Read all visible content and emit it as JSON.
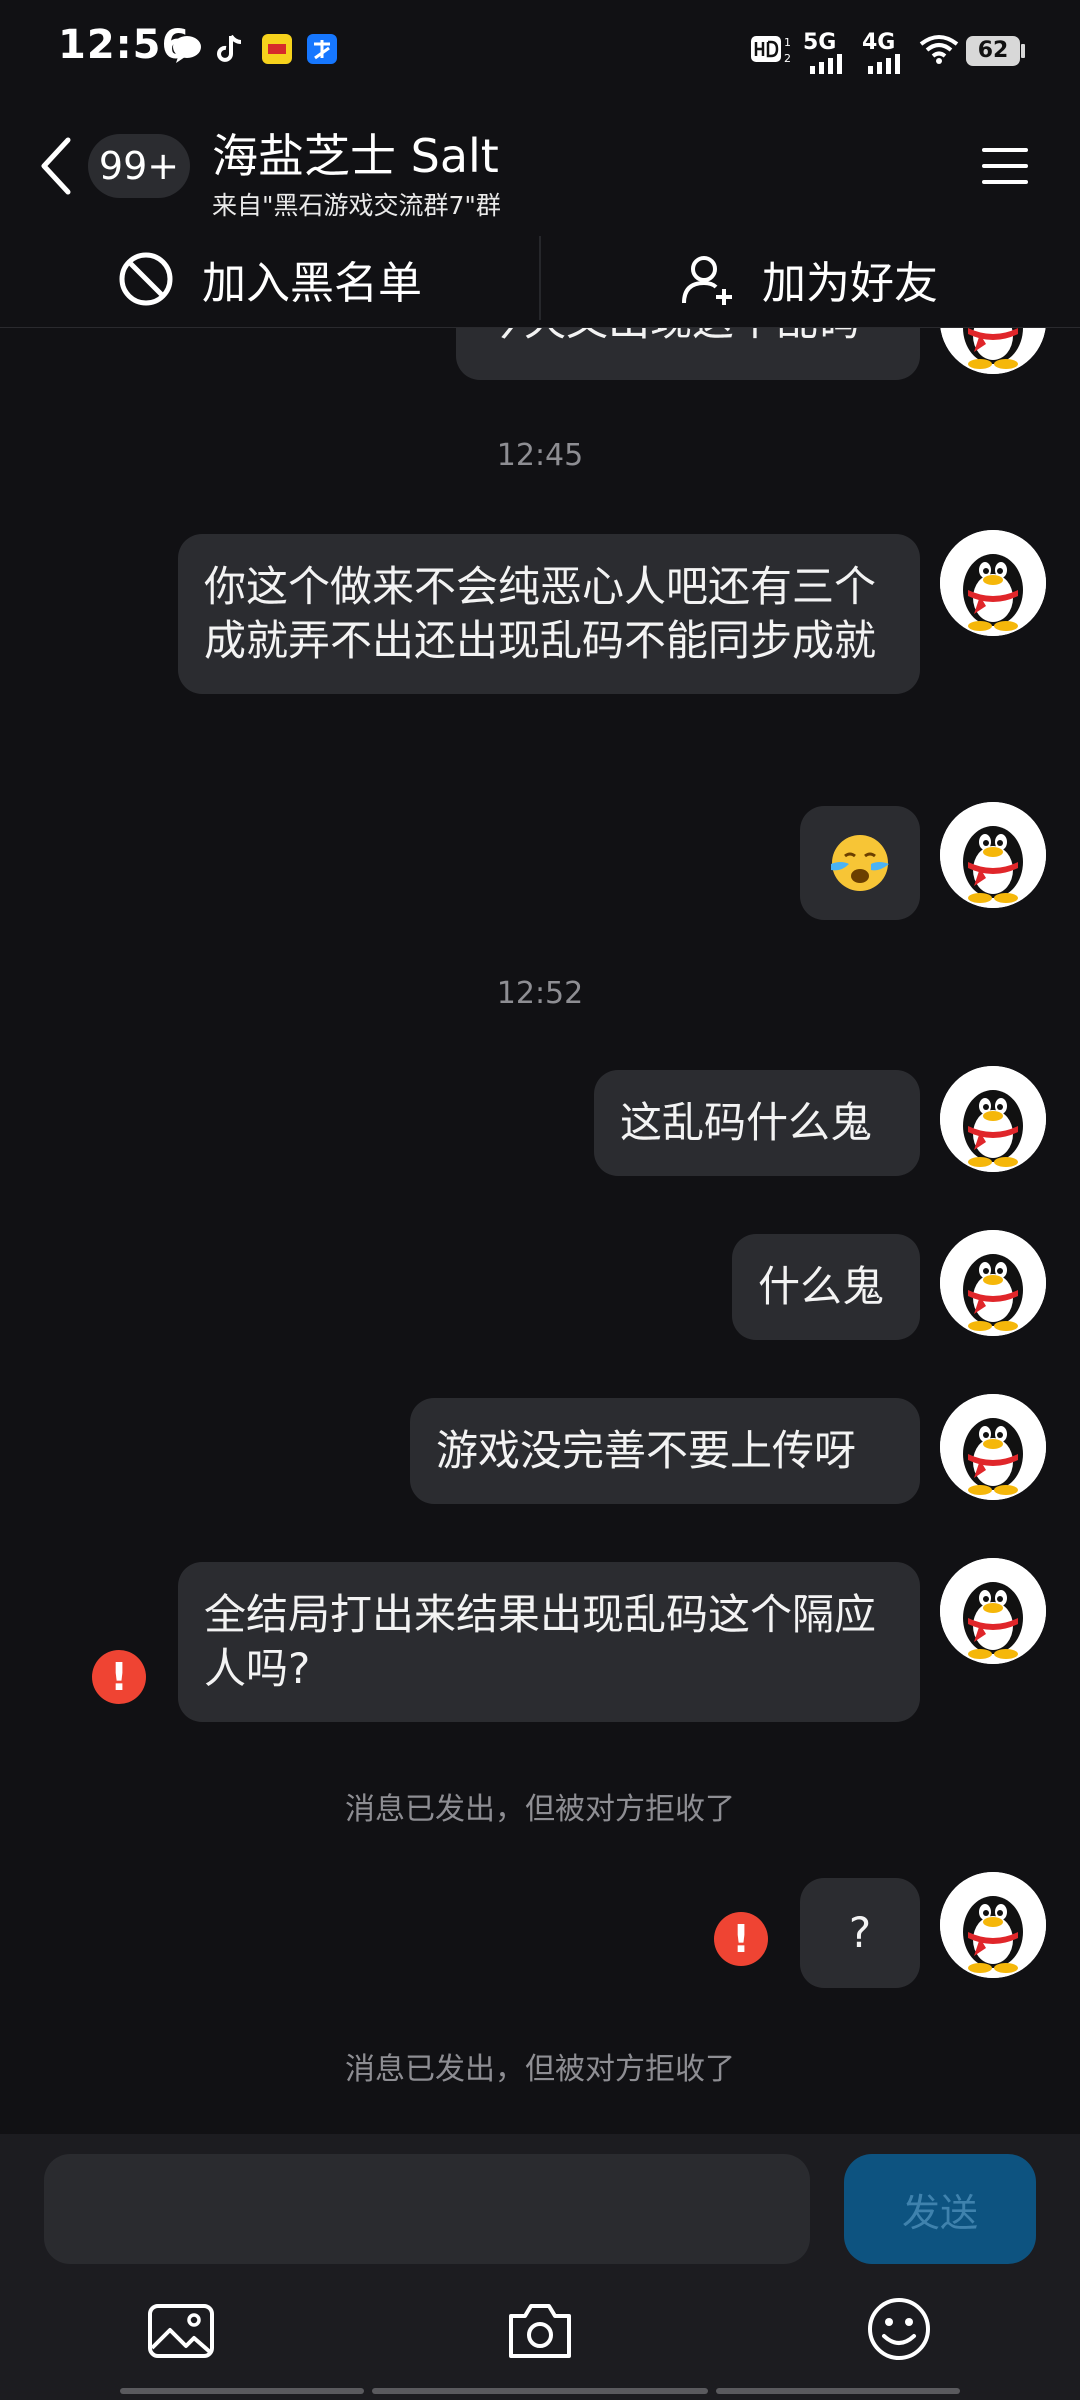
{
  "status_bar": {
    "time": "12:56",
    "hd_label": "HD",
    "net1": "5G",
    "net2": "4G",
    "battery": "62"
  },
  "header": {
    "badge": "99+",
    "title": "海盐芝士 Salt",
    "subtitle": "来自\"黑石游戏交流群7\"群"
  },
  "actions": {
    "block": "加入黑名单",
    "add_friend": "加为好友"
  },
  "chat": {
    "partial_message": "今天又出现这个乱码",
    "timestamp_1": "12:45",
    "msg_1": "你这个做来不会纯恶心人吧还有三个成就弄不出还出现乱码不能同步成就",
    "emoji_msg": "😭",
    "timestamp_2": "12:52",
    "msg_2": "这乱码什么鬼",
    "msg_3": "什么鬼",
    "msg_4": "游戏没完善不要上传呀",
    "msg_5": "全结局打出来结果出现乱码这个隔应人吗?",
    "notice_1": "消息已发出，但被对方拒收了",
    "msg_6": "?",
    "notice_2": "消息已发出，但被对方拒收了",
    "error_mark": "!"
  },
  "input": {
    "send_label": "发送"
  },
  "colors": {
    "background": "#111114",
    "bubble": "#2b2c30",
    "error": "#ef4433",
    "send_button": "#0d5380"
  }
}
